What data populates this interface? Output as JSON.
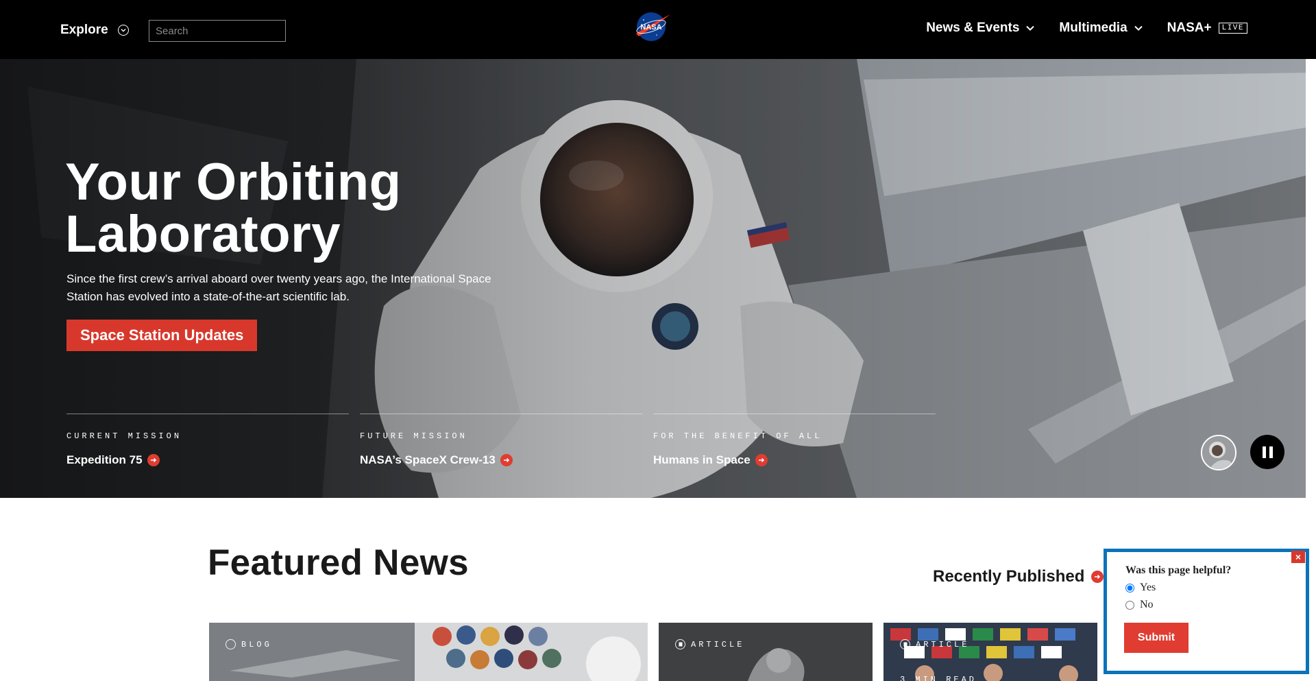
{
  "header": {
    "explore_label": "Explore",
    "search_placeholder": "Search",
    "logo_text": "NASA",
    "nav": [
      {
        "label": "News & Events"
      },
      {
        "label": "Multimedia"
      },
      {
        "label": "NASA+",
        "badge": "LIVE"
      }
    ]
  },
  "hero": {
    "title_line1": "Your Orbiting",
    "title_line2": "Laboratory",
    "subtitle": "Since the first crew’s arrival aboard over twenty years ago, the International Space Station has evolved into a state-of-the-art scientific lab.",
    "button_label": "Space Station Updates",
    "missions": [
      {
        "label": "CURRENT MISSION",
        "link": "Expedition 75"
      },
      {
        "label": "FUTURE MISSION",
        "link": "NASA’s SpaceX Crew-13"
      },
      {
        "label": "FOR THE BENEFIT OF ALL",
        "link": "Humans in Space"
      }
    ]
  },
  "featured": {
    "title": "Featured News",
    "recently_published": "Recently Published",
    "cards": [
      {
        "tag": "BLOG"
      },
      {
        "tag": "ARTICLE"
      },
      {
        "tag": "ARTICLE",
        "read_time": "3 MIN READ"
      }
    ]
  },
  "feedback": {
    "question": "Was this page helpful?",
    "option_yes": "Yes",
    "option_no": "No",
    "submit_label": "Submit",
    "close_symbol": "×"
  },
  "colors": {
    "accent_red": "#e03c31",
    "feedback_border": "#0b73b8",
    "header_bg": "#000000"
  }
}
